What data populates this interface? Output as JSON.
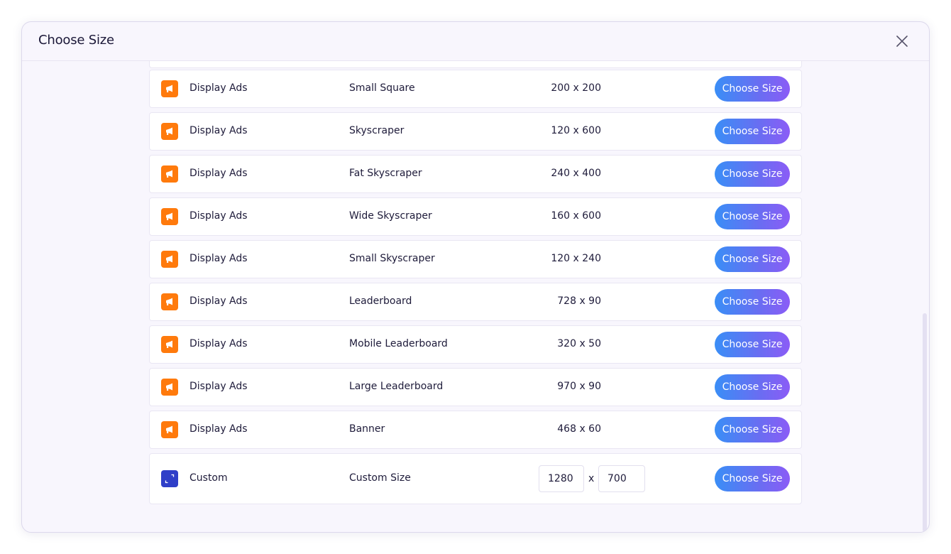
{
  "modal": {
    "title": "Choose Size",
    "close_icon": "close-icon"
  },
  "rows": [
    {
      "category": "Display Ads",
      "name": "Small Square",
      "dims": "200 x 200",
      "button": "Choose Size",
      "icon": "megaphone-icon"
    },
    {
      "category": "Display Ads",
      "name": "Skyscraper",
      "dims": "120 x 600",
      "button": "Choose Size",
      "icon": "megaphone-icon"
    },
    {
      "category": "Display Ads",
      "name": "Fat Skyscraper",
      "dims": "240 x 400",
      "button": "Choose Size",
      "icon": "megaphone-icon"
    },
    {
      "category": "Display Ads",
      "name": "Wide Skyscraper",
      "dims": "160 x 600",
      "button": "Choose Size",
      "icon": "megaphone-icon"
    },
    {
      "category": "Display Ads",
      "name": "Small Skyscraper",
      "dims": "120 x 240",
      "button": "Choose Size",
      "icon": "megaphone-icon"
    },
    {
      "category": "Display Ads",
      "name": "Leaderboard",
      "dims": "728 x 90",
      "button": "Choose Size",
      "icon": "megaphone-icon"
    },
    {
      "category": "Display Ads",
      "name": "Mobile Leaderboard",
      "dims": "320 x 50",
      "button": "Choose Size",
      "icon": "megaphone-icon"
    },
    {
      "category": "Display Ads",
      "name": "Large Leaderboard",
      "dims": "970 x 90",
      "button": "Choose Size",
      "icon": "megaphone-icon"
    },
    {
      "category": "Display Ads",
      "name": "Banner",
      "dims": "468 x 60",
      "button": "Choose Size",
      "icon": "megaphone-icon"
    }
  ],
  "custom": {
    "category": "Custom",
    "name": "Custom Size",
    "width_value": "1280",
    "separator": "x",
    "height_value": "700",
    "button": "Choose Size",
    "icon": "resize-icon"
  },
  "colors": {
    "display_ads_icon": "#ff7a0c",
    "custom_icon": "#2f3fc8",
    "button_gradient_start": "#3a8ef6",
    "button_gradient_end": "#8b5cf6"
  }
}
